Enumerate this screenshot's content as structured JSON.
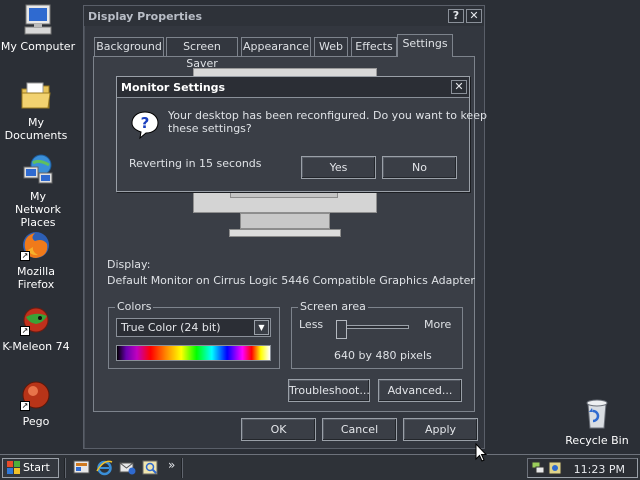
{
  "desktop": {
    "icons": [
      {
        "label": "My Computer",
        "icon": "computer-icon"
      },
      {
        "label": "My Documents",
        "icon": "folder-icon"
      },
      {
        "label": "My Network Places",
        "icon": "network-icon"
      },
      {
        "label": "Mozilla Firefox",
        "icon": "firefox-icon"
      },
      {
        "label": "K-Meleon 74",
        "icon": "kmeleon-icon"
      },
      {
        "label": "Pego",
        "icon": "pego-icon"
      },
      {
        "label": "Recycle Bin",
        "icon": "recycle-bin-icon"
      }
    ]
  },
  "window": {
    "title": "Display Properties",
    "help_btn": "?",
    "close_btn": "✕",
    "tabs": [
      "Background",
      "Screen Saver",
      "Appearance",
      "Web",
      "Effects",
      "Settings"
    ],
    "active_tab": "Settings",
    "display_label": "Display:",
    "display_value": "Default Monitor on Cirrus Logic 5446 Compatible Graphics Adapter",
    "colors": {
      "label": "Colors",
      "selected": "True Color (24 bit)"
    },
    "screen_area": {
      "label": "Screen area",
      "less": "Less",
      "more": "More",
      "resolution": "640 by 480 pixels",
      "slider_position": 0
    },
    "buttons": {
      "troubleshoot": "Troubleshoot...",
      "advanced": "Advanced...",
      "ok": "OK",
      "cancel": "Cancel",
      "apply": "Apply"
    }
  },
  "dialog": {
    "title": "Monitor Settings",
    "close_btn": "✕",
    "message_line1": "Your desktop has been reconfigured.  Do you want to keep",
    "message_line2": "these settings?",
    "countdown": "Reverting in 15 seconds",
    "yes": "Yes",
    "no": "No"
  },
  "taskbar": {
    "start": "Start",
    "chevron": "»",
    "clock": "11:23 PM"
  }
}
